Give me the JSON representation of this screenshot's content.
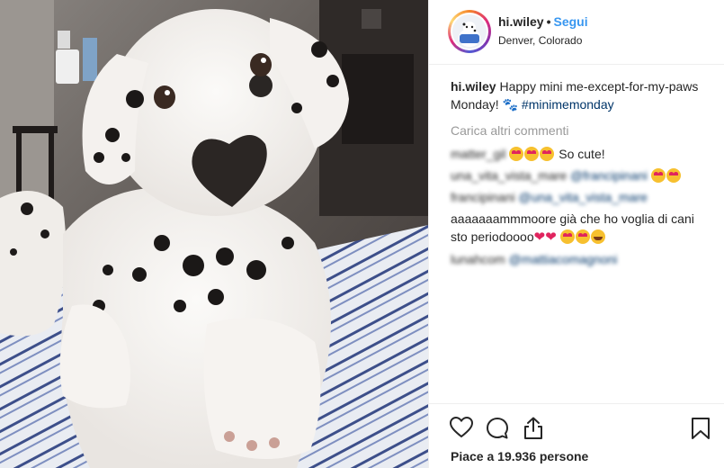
{
  "post": {
    "username": "hi.wiley",
    "separator": "•",
    "follow_label": "Segui",
    "location": "Denver, Colorado"
  },
  "caption": {
    "username": "hi.wiley",
    "text_before": "Happy mini me-except-for-my-paws Monday!",
    "hashtag": "#minimemonday"
  },
  "load_more_label": "Carica altri commenti",
  "comments": [
    {
      "user": "matter_gil",
      "text": "So cute!"
    },
    {
      "user": "una_vita_vista_mare",
      "mention": "@francipinani"
    },
    {
      "user": "francipinani",
      "mention": "@una_vita_vista_mare"
    },
    {
      "user": "aaaaaaammmoore",
      "text": "già che ho voglia di cani sto periodoooo"
    },
    {
      "user": "lunahcom",
      "mention": "@mattiacomagnoni"
    }
  ],
  "likes": {
    "prefix": "Piace a",
    "count": "19.936",
    "suffix": "persone"
  },
  "icons": [
    "heart-icon",
    "comment-icon",
    "share-icon",
    "bookmark-icon"
  ],
  "colors": {
    "accent": "#3897f0",
    "hashtag": "#003569",
    "muted": "#999999"
  }
}
